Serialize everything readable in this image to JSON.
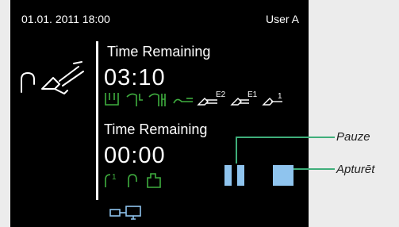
{
  "status": {
    "datetime": "01.01. 2011 18:00",
    "user": "User A"
  },
  "timer1": {
    "label": "Time Remaining",
    "value": "03:10"
  },
  "timer2": {
    "label": "Time Remaining",
    "value": "00:00"
  },
  "instrument_icons": {
    "e2": "E2",
    "e1": "E1",
    "one": "1"
  },
  "water_icons": {
    "one": "1"
  },
  "callouts": {
    "pause": "Pauze",
    "stop": "Apturēt"
  },
  "colors": {
    "accent_green": "#3fae3f",
    "button_blue": "#8fc4ee",
    "callout_line": "#3fae7a"
  }
}
